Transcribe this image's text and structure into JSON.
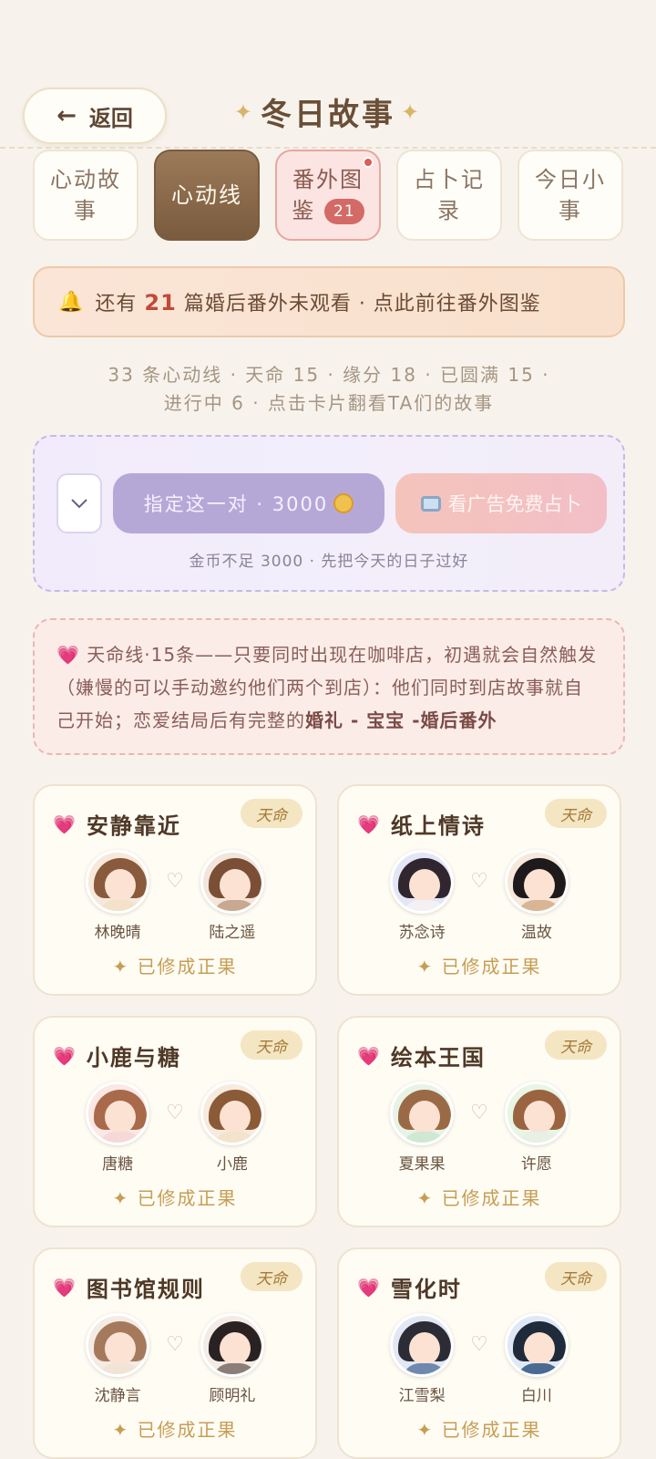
{
  "header": {
    "back_label": "返回",
    "title": "冬日故事"
  },
  "tabs": [
    {
      "label": "心动故事"
    },
    {
      "label": "心动线"
    },
    {
      "label": "番外图鉴",
      "count": "21"
    },
    {
      "label": "占卜记录"
    },
    {
      "label": "今日小事"
    }
  ],
  "notice": {
    "prefix": "还有",
    "count": "21",
    "suffix": "篇婚后番外未观看 · 点此前往番外图鉴"
  },
  "stats": {
    "line1": "33 条心动线 · 天命 15 · 缘分 18 · 已圆满 15 ·",
    "line2": "进行中 6 · 点击卡片翻看TA们的故事"
  },
  "fortune": {
    "pick_label": "指定这一对 · 3000",
    "ad_label": "看广告免费占卜",
    "hint": "金币不足 3000 · 先把今天的日子过好"
  },
  "destiny": {
    "text": "天命线·15条——只要同时出现在咖啡店，初遇就会自然触发（嫌慢的可以手动邀约他们两个到店）：他们同时到店故事就自己开始；恋爱结局后有完整的",
    "bold": "婚礼 - 宝宝 -婚后番外"
  },
  "cards": [
    {
      "title": "安静靠近",
      "tag": "天命",
      "a": "林晚晴",
      "b": "陆之遥",
      "status": "已修成正果"
    },
    {
      "title": "纸上情诗",
      "tag": "天命",
      "a": "苏念诗",
      "b": "温故",
      "status": "已修成正果"
    },
    {
      "title": "小鹿与糖",
      "tag": "天命",
      "a": "唐糖",
      "b": "小鹿",
      "status": "已修成正果"
    },
    {
      "title": "绘本王国",
      "tag": "天命",
      "a": "夏果果",
      "b": "许愿",
      "status": "已修成正果"
    },
    {
      "title": "图书馆规则",
      "tag": "天命",
      "a": "沈静言",
      "b": "顾明礼",
      "status": "已修成正果"
    },
    {
      "title": "雪化时",
      "tag": "天命",
      "a": "江雪梨",
      "b": "白川",
      "status": "已修成正果"
    }
  ]
}
